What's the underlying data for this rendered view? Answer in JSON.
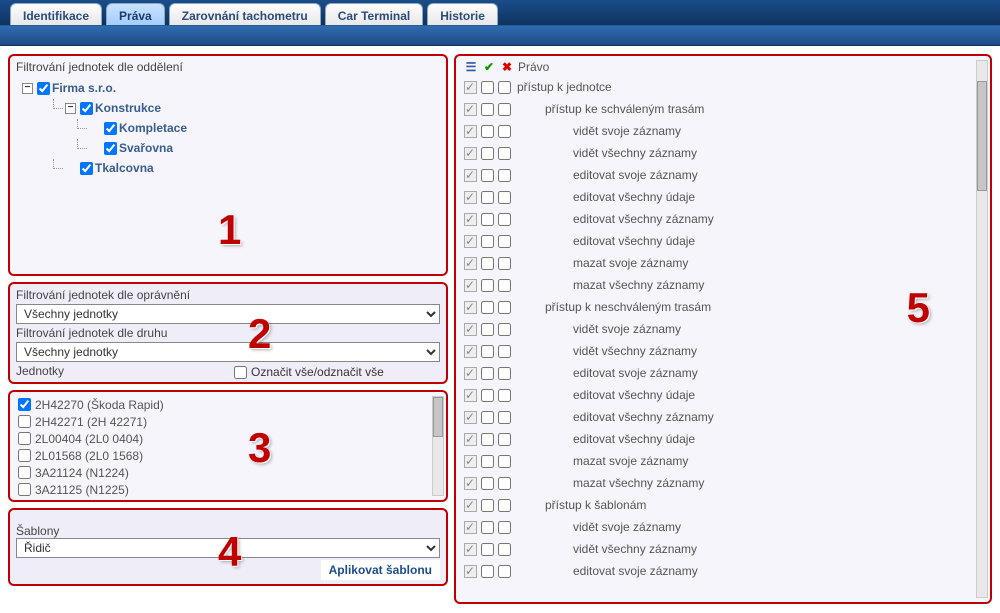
{
  "tabs": [
    {
      "label": "Identifikace"
    },
    {
      "label": "Práva"
    },
    {
      "label": "Zarovnání tachometru"
    },
    {
      "label": "Car Terminal"
    },
    {
      "label": "Historie"
    }
  ],
  "activeTab": 1,
  "panel1": {
    "title": "Filtrování jednotek dle oddělení",
    "tree": [
      {
        "label": "Firma s.r.o.",
        "level": 0,
        "expanded": true,
        "checked": true
      },
      {
        "label": "Konstrukce",
        "level": 1,
        "expanded": true,
        "checked": true
      },
      {
        "label": "Kompletace",
        "level": 2,
        "checked": true
      },
      {
        "label": "Svařovna",
        "level": 2,
        "checked": true
      },
      {
        "label": "Tkalcovna",
        "level": 1,
        "checked": true
      }
    ],
    "numeral": "1"
  },
  "panel2": {
    "filt1_label": "Filtrování jednotek dle oprávnění",
    "filt1_value": "Všechny jednotky",
    "filt2_label": "Filtrování jednotek dle druhu",
    "filt2_value": "Všechny jednotky",
    "units_label": "Jednotky",
    "mark_all": "Označit vše/odznačit vše",
    "numeral": "2"
  },
  "panel3": {
    "units": [
      {
        "label": "2H42270 (Škoda Rapid)",
        "checked": true
      },
      {
        "label": "2H42271 (2H 42271)",
        "checked": false
      },
      {
        "label": "2L00404 (2L0 0404)",
        "checked": false
      },
      {
        "label": "2L01568 (2L0 1568)",
        "checked": false
      },
      {
        "label": "3A21124 (N1224)",
        "checked": false
      },
      {
        "label": "3A21125 (N1225)",
        "checked": false
      }
    ],
    "numeral": "3"
  },
  "panel4": {
    "label": "Šablony",
    "value": "Řidič",
    "apply": "Aplikovat šablonu",
    "numeral": "4"
  },
  "panel5": {
    "head": "Právo",
    "numeral": "5",
    "rights": [
      {
        "label": "přístup k jednotce",
        "indent": 1
      },
      {
        "label": "přístup ke schváleným trasám",
        "indent": 2
      },
      {
        "label": "vidět svoje záznamy",
        "indent": 3
      },
      {
        "label": "vidět všechny záznamy",
        "indent": 3
      },
      {
        "label": "editovat svoje záznamy",
        "indent": 3
      },
      {
        "label": "editovat všechny údaje",
        "indent": 3
      },
      {
        "label": "editovat všechny záznamy",
        "indent": 3
      },
      {
        "label": "editovat všechny údaje",
        "indent": 3
      },
      {
        "label": "mazat svoje záznamy",
        "indent": 3
      },
      {
        "label": "mazat všechny záznamy",
        "indent": 3
      },
      {
        "label": "přístup k neschváleným trasám",
        "indent": 2
      },
      {
        "label": "vidět svoje záznamy",
        "indent": 3
      },
      {
        "label": "vidět všechny záznamy",
        "indent": 3
      },
      {
        "label": "editovat svoje záznamy",
        "indent": 3
      },
      {
        "label": "editovat všechny údaje",
        "indent": 3
      },
      {
        "label": "editovat všechny záznamy",
        "indent": 3
      },
      {
        "label": "editovat všechny údaje",
        "indent": 3
      },
      {
        "label": "mazat svoje záznamy",
        "indent": 3
      },
      {
        "label": "mazat všechny záznamy",
        "indent": 3
      },
      {
        "label": "přístup k šablonám",
        "indent": 2
      },
      {
        "label": "vidět svoje záznamy",
        "indent": 3
      },
      {
        "label": "vidět všechny záznamy",
        "indent": 3
      },
      {
        "label": "editovat svoje záznamy",
        "indent": 3
      }
    ]
  }
}
